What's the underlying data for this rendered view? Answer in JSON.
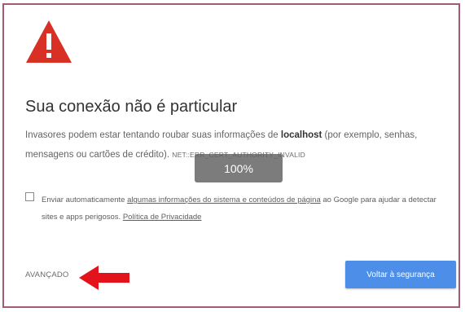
{
  "interstitial": {
    "title": "Sua conexão não é particular",
    "message_before_host": "Invasores podem estar tentando roubar suas informações de ",
    "host": "localhost",
    "message_after_host": " (por exemplo, senhas, mensagens ou cartões de crédito).",
    "error_code": "NET::ERR_CERT_AUTHORITY_INVALID",
    "report": {
      "before_link": "Enviar automaticamente ",
      "link_text": "algumas informações do sistema e conteúdos de página",
      "after_link": " ao Google para ajudar a detectar sites e apps perigosos. ",
      "privacy_link": "Política de Privacidade",
      "checked": false
    },
    "advanced_label": "AVANÇADO",
    "back_button_label": "Voltar à segurança"
  },
  "zoom_badge": "100%",
  "colors": {
    "warning_icon": "#d93025",
    "frame_border": "#a35a72",
    "button_bg": "#4c8ee8",
    "annotation_arrow": "#e3121b"
  },
  "icons": {
    "warning": "warning-triangle-icon",
    "arrow": "red-arrow-annotation"
  }
}
